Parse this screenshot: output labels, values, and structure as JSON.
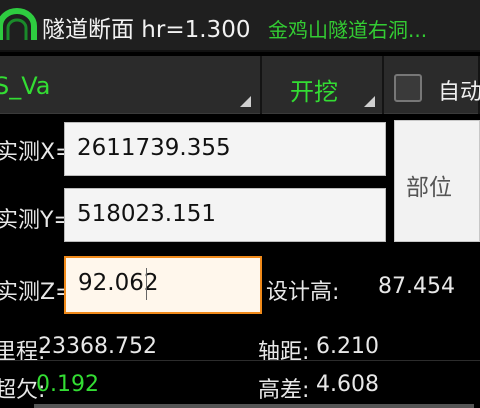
{
  "header": {
    "title": "隧道断面 hr=1.300",
    "project": "金鸡山隧道右洞..."
  },
  "toolbar": {
    "series": "S_Va",
    "mode": "开挖",
    "auto_label": "自动",
    "auto_checked": false
  },
  "form": {
    "x_label": "实测X=",
    "x_value": "2611739.355",
    "y_label": "实测Y=",
    "y_value": "518023.151",
    "z_label": "实测Z=",
    "z_value": "92.062",
    "part_button": "部位",
    "design_height_label": "设计高:",
    "design_height_value": "87.454"
  },
  "results": {
    "chainage_label": "里程:",
    "chainage_value": "23368.752",
    "offset_label": "轴距:",
    "offset_value": "6.210",
    "over_under_label": "超欠:",
    "over_under_value": "0.192",
    "height_diff_label": "高差:",
    "height_diff_value": "4.608"
  },
  "colors": {
    "accent_green": "#33dd33",
    "focus_orange": "#f08a1a"
  }
}
